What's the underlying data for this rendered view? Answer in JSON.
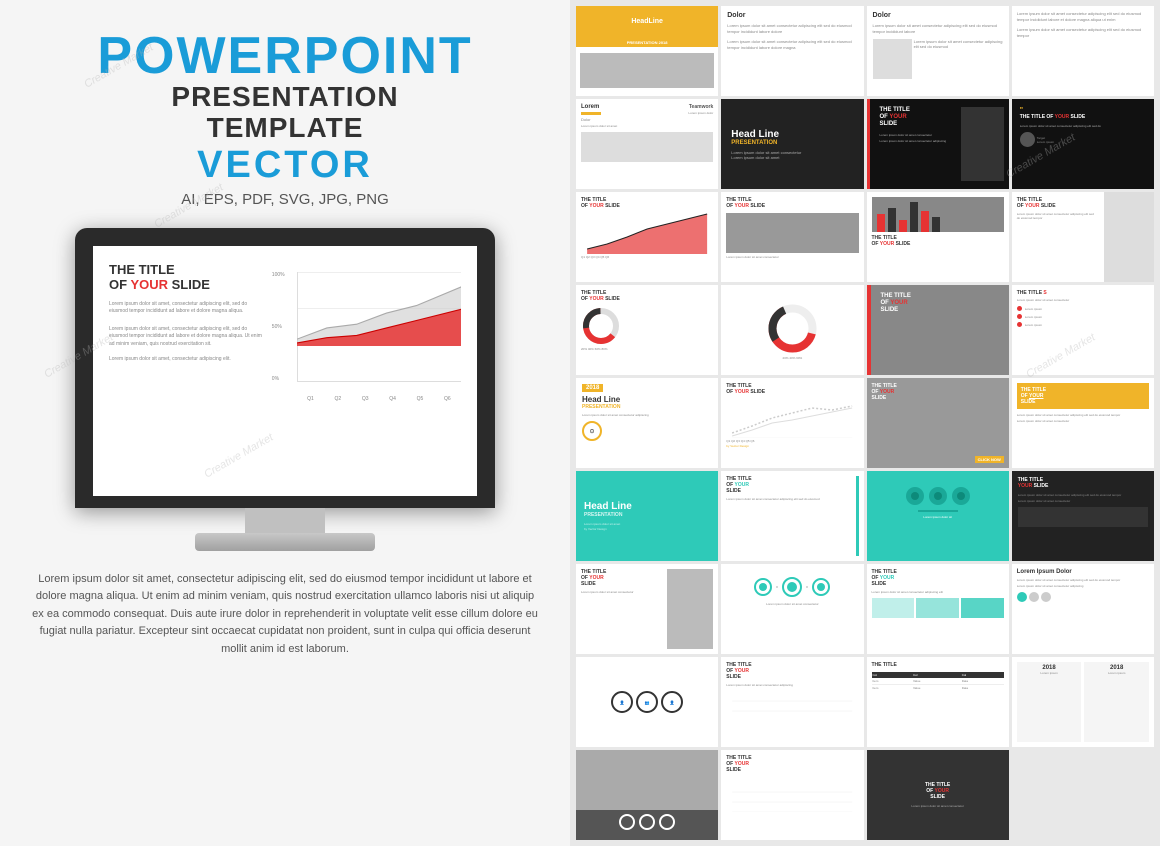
{
  "left": {
    "title_line1": "POWERPOINT",
    "title_line2": "PRESENTATION TEMPLATE",
    "title_line3": "VECTOR",
    "formats": "AI, EPS, PDF, SVG, JPG, PNG",
    "slide_title": "THE TITLE",
    "slide_title2": "OF YOUR SLIDE",
    "your_label": "YOUR",
    "body_text1": "Lorem ipsum dolor sit amet, consectetur adipiscing elit, sed do eiusmod tempor",
    "body_text2": "Lorem ipsum dolor sit amet, consectetur adipiscing elit, sed do eiusmod tempor incididunt at labore et",
    "chart_y1": "100%",
    "chart_y2": "50%",
    "chart_y3": "0%",
    "chart_x": [
      "Q1",
      "Q2",
      "Q3",
      "Q4",
      "Q5",
      "Q6"
    ],
    "description": "Lorem ipsum dolor sit amet, consectetur adipiscing elit, sed do eiusmod tempor incididunt ut labore et dolore magna\naliqua. Ut enim ad minim veniam, quis nostrud exercitation ullamco laboris nisi ut aliquip ex ea commodo consequat. Duis\naute irure dolor in reprehenderit in voluptate velit esse cillum dolore eu fugiat nulla pariatur. Excepteur sint occaecat\ncupidatat non proident, sunt in culpa qui officia deserunt mollit anim id est laborum."
  },
  "right": {
    "slides": [
      {
        "type": "yellow-header",
        "title": "HeadLine",
        "subtitle": "PRESENTATION 2018"
      },
      {
        "type": "dark-text",
        "title": "Dolor"
      },
      {
        "type": "dark-text-gray",
        "title": "Dolor"
      },
      {
        "type": "blank-text",
        "label": ""
      },
      {
        "type": "lorem-teamwork",
        "label1": "Lorem",
        "label2": "Teamwork"
      },
      {
        "type": "headline-dark",
        "title": "Head Line",
        "subtitle": "PRESENTATION"
      },
      {
        "type": "title-slide-dark",
        "title": "THE TITLE OF YOUR SLIDE"
      },
      {
        "type": "title-slide-dark-quote",
        "title": "THE TITLE OF YOUR SLIDE"
      },
      {
        "type": "chart-slide",
        "title": "THE TITLE OF YOUR SLIDE"
      },
      {
        "type": "photo-title",
        "title": "THE TITLE OF YOUR SLIDE"
      },
      {
        "type": "photo-bar",
        "title": ""
      },
      {
        "type": "blank-right",
        "title": "THE TITLE OF YOUR SLIDE"
      },
      {
        "type": "donut-slide",
        "title": "THE TITLE OF YOUR SLIDE"
      },
      {
        "type": "donut-chart-center",
        "label": ""
      },
      {
        "type": "photo-dark",
        "title": "THE TITLE OF YOUR SLIDE"
      },
      {
        "type": "title-red-dot",
        "title": "THE TITLE"
      },
      {
        "type": "year-slide",
        "year": "2018",
        "title": "Head Line",
        "subtitle": "PRESENTATION"
      },
      {
        "type": "chart-line",
        "title": "THE TITLE OF YOUR SLIDE"
      },
      {
        "type": "photo-mid",
        "title": "THE TITLE OF YOUR SLIDE"
      },
      {
        "type": "title-orange",
        "title": "THE TITLE OF YOUR SLIDE"
      },
      {
        "type": "teal-team",
        "title": "Head Line",
        "subtitle": "PRESENTATION"
      },
      {
        "type": "title-teal",
        "title": "THE TITLE OF YOUR SLIDE"
      },
      {
        "type": "teal-avatars",
        "label": ""
      },
      {
        "type": "title-dark2",
        "title": "THE TITLE YOUR SLIDE"
      },
      {
        "type": "person-slide",
        "title": "THE TITLE OF YOUR SLIDE"
      },
      {
        "type": "infographic",
        "label": ""
      },
      {
        "type": "title-white-teal",
        "title": "THE TITLE OF YOUR SLIDE"
      },
      {
        "type": "lorem-ipsum",
        "label": "Lorem Ipsum Dolor"
      },
      {
        "type": "three-circles",
        "label": ""
      },
      {
        "type": "title-slide-b",
        "title": "THE TITLE OF YOUR SLIDE"
      },
      {
        "type": "table-slide",
        "label": ""
      },
      {
        "type": "year-2018b",
        "year": "2018"
      },
      {
        "type": "blank-photo2",
        "label": ""
      },
      {
        "type": "title-slide-c",
        "title": "THE TITLE OF YOUR SLIDE"
      },
      {
        "type": "blank-end",
        "label": ""
      }
    ],
    "watermarks": [
      "Creative Market",
      "Creative Market",
      "Creative Market",
      "Creative Market"
    ]
  }
}
